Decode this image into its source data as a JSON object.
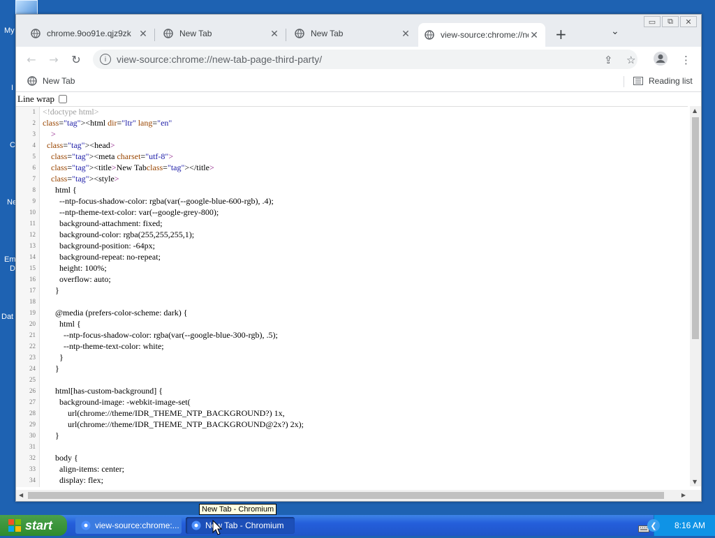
{
  "desktop": {
    "labels": [
      "My",
      "I",
      "C",
      "Ne",
      "Em",
      "D",
      "Dat"
    ]
  },
  "window": {
    "controls": {
      "minimize": "▭",
      "restore": "⧉",
      "close": "✕"
    }
  },
  "tabs": [
    {
      "title": "chrome.9oo91e.qjz9zk",
      "active": false
    },
    {
      "title": "New Tab",
      "active": false
    },
    {
      "title": "New Tab",
      "active": false
    },
    {
      "title": "view-source:chrome://ne",
      "active": true
    }
  ],
  "toolbar": {
    "url": "view-source:chrome://new-tab-page-third-party/"
  },
  "bookmarks": {
    "left": "New Tab",
    "right": "Reading list"
  },
  "source": {
    "linewrap_label": "Line wrap",
    "lines": [
      {
        "n": "1",
        "t": "<!doctype html>",
        "dim": true
      },
      {
        "n": "2",
        "t": "<html dir=\"ltr\" lang=\"en\""
      },
      {
        "n": "3",
        "t": "    >"
      },
      {
        "n": "4",
        "t": "  <head>"
      },
      {
        "n": "5",
        "t": "    <meta charset=\"utf-8\">"
      },
      {
        "n": "6",
        "t": "    <title>New Tab</title>"
      },
      {
        "n": "7",
        "t": "    <style>"
      },
      {
        "n": "8",
        "t": "      html {"
      },
      {
        "n": "9",
        "t": "        --ntp-focus-shadow-color: rgba(var(--google-blue-600-rgb), .4);"
      },
      {
        "n": "10",
        "t": "        --ntp-theme-text-color: var(--google-grey-800);"
      },
      {
        "n": "11",
        "t": "        background-attachment: fixed;"
      },
      {
        "n": "12",
        "t": "        background-color: rgba(255,255,255,1);"
      },
      {
        "n": "13",
        "t": "        background-position: -64px;"
      },
      {
        "n": "14",
        "t": "        background-repeat: no-repeat;"
      },
      {
        "n": "15",
        "t": "        height: 100%;"
      },
      {
        "n": "16",
        "t": "        overflow: auto;"
      },
      {
        "n": "17",
        "t": "      }"
      },
      {
        "n": "18",
        "t": ""
      },
      {
        "n": "19",
        "t": "      @media (prefers-color-scheme: dark) {"
      },
      {
        "n": "20",
        "t": "        html {"
      },
      {
        "n": "21",
        "t": "          --ntp-focus-shadow-color: rgba(var(--google-blue-300-rgb), .5);"
      },
      {
        "n": "22",
        "t": "          --ntp-theme-text-color: white;"
      },
      {
        "n": "23",
        "t": "        }"
      },
      {
        "n": "24",
        "t": "      }"
      },
      {
        "n": "25",
        "t": ""
      },
      {
        "n": "26",
        "t": "      html[has-custom-background] {"
      },
      {
        "n": "27",
        "t": "        background-image: -webkit-image-set("
      },
      {
        "n": "28",
        "t": "            url(chrome://theme/IDR_THEME_NTP_BACKGROUND?) 1x,"
      },
      {
        "n": "29",
        "t": "            url(chrome://theme/IDR_THEME_NTP_BACKGROUND@2x?) 2x);"
      },
      {
        "n": "30",
        "t": "      }"
      },
      {
        "n": "31",
        "t": ""
      },
      {
        "n": "32",
        "t": "      body {"
      },
      {
        "n": "33",
        "t": "        align-items: center;"
      },
      {
        "n": "34",
        "t": "        display: flex;"
      }
    ]
  },
  "tooltip": "New Tab - Chromium",
  "taskbar": {
    "start_label": "start",
    "buttons": [
      {
        "label": "view-source:chrome:...",
        "active": false
      },
      {
        "label": "New Tab - Chromium",
        "active": true
      }
    ],
    "clock": "8:16 AM"
  }
}
